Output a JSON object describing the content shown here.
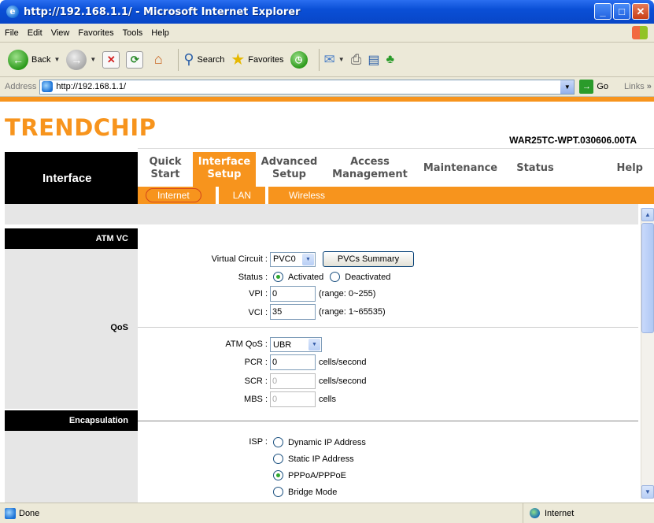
{
  "window": {
    "title": "http://192.168.1.1/ - Microsoft Internet Explorer"
  },
  "menu": [
    "File",
    "Edit",
    "View",
    "Favorites",
    "Tools",
    "Help"
  ],
  "toolbar": {
    "back": "Back",
    "search": "Search",
    "favorites": "Favorites"
  },
  "address": {
    "label": "Address",
    "url": "http://192.168.1.1/",
    "go": "Go",
    "links": "Links",
    "links_more": "»"
  },
  "brand": {
    "logo": "TRENDCHIP",
    "model": "WAR25TC-WPT.030606.00TA"
  },
  "nav": {
    "section": "Interface",
    "tabs": [
      {
        "label": "Quick Start"
      },
      {
        "label": "Interface Setup"
      },
      {
        "label": "Advanced Setup"
      },
      {
        "label": "Access Management"
      },
      {
        "label": "Maintenance"
      },
      {
        "label": "Status"
      },
      {
        "label": "Help"
      }
    ],
    "subtabs": [
      "Internet",
      "LAN",
      "Wireless"
    ]
  },
  "sections": {
    "atm_vc": "ATM VC",
    "qos": "QoS",
    "encapsulation": "Encapsulation"
  },
  "form": {
    "virtual_circuit": {
      "label": "Virtual Circuit :",
      "value": "PVC0",
      "button": "PVCs Summary"
    },
    "status": {
      "label": "Status :",
      "activated": "Activated",
      "deactivated": "Deactivated"
    },
    "vpi": {
      "label": "VPI :",
      "value": "0",
      "hint": "(range: 0~255)"
    },
    "vci": {
      "label": "VCI :",
      "value": "35",
      "hint": "(range: 1~65535)"
    },
    "atm_qos": {
      "label": "ATM QoS :",
      "value": "UBR"
    },
    "pcr": {
      "label": "PCR :",
      "value": "0",
      "unit": "cells/second"
    },
    "scr": {
      "label": "SCR :",
      "value": "0",
      "unit": "cells/second"
    },
    "mbs": {
      "label": "MBS :",
      "value": "0",
      "unit": "cells"
    },
    "isp": {
      "label": "ISP :",
      "options": [
        "Dynamic IP Address",
        "Static IP Address",
        "PPPoA/PPPoE",
        "Bridge Mode"
      ]
    }
  },
  "statusbar": {
    "left": "Done",
    "zone": "Internet"
  }
}
